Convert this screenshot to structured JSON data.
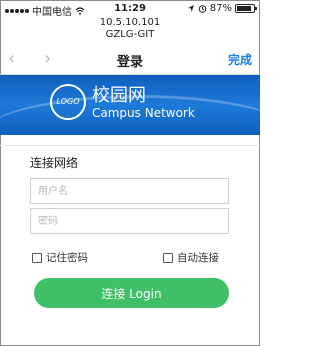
{
  "status_bar": {
    "carrier": "中国电信",
    "time": "11:29",
    "battery": "87%"
  },
  "address": {
    "ip": "10.5.10.101",
    "host": "GZLG-GIT"
  },
  "nav": {
    "back": "‹",
    "forward": "›",
    "title": "登录",
    "done": "完成"
  },
  "banner": {
    "logo_text": "LOGO",
    "title_cn": "校园网",
    "title_en": "Campus Network"
  },
  "form": {
    "section_title": "连接网络",
    "username_placeholder": "用户名",
    "password_placeholder": "密码",
    "remember_label": "记住密码",
    "auto_label": "自动连接",
    "login_label": "连接 Login"
  },
  "colors": {
    "accent_link": "#1a7fe0",
    "banner_blue": "#1d7ad8",
    "login_green": "#3fbf66"
  }
}
